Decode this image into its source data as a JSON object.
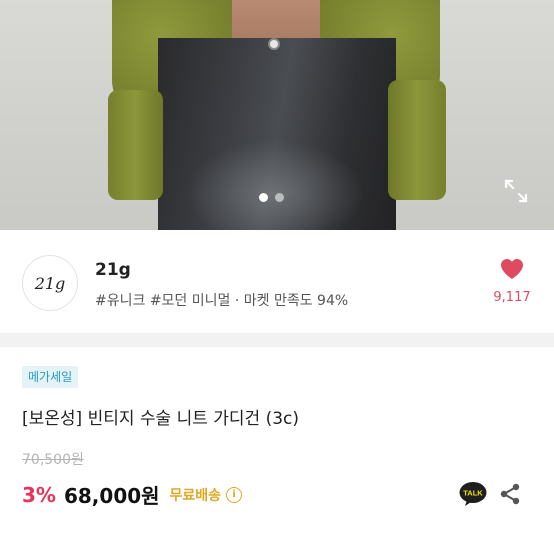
{
  "gallery": {
    "slide_count": 2,
    "active_slide": 1
  },
  "shop": {
    "logo_text": "21g",
    "name": "21g",
    "tags": "#유니크 #모던 미니멀 · 마켓 만족도 94%",
    "like_count": "9,117"
  },
  "product": {
    "badge": "메가세일",
    "title": "[보온성] 빈티지 수술 니트 가디건 (3c)",
    "original_price": "70,500원",
    "discount": "3%",
    "price": "68,000원",
    "shipping": "무료배송",
    "info_glyph": "i",
    "talk_label": "TALK"
  },
  "colors": {
    "accent_red": "#e8345b",
    "heart": "#e04a60",
    "shipping": "#e0a826",
    "badge_text": "#2a9bc2",
    "badge_bg": "#e4f3f8"
  },
  "icons": {
    "expand": "expand-icon",
    "heart": "heart-icon",
    "talk": "kakao-talk-icon",
    "share": "share-icon",
    "info": "info-icon"
  }
}
